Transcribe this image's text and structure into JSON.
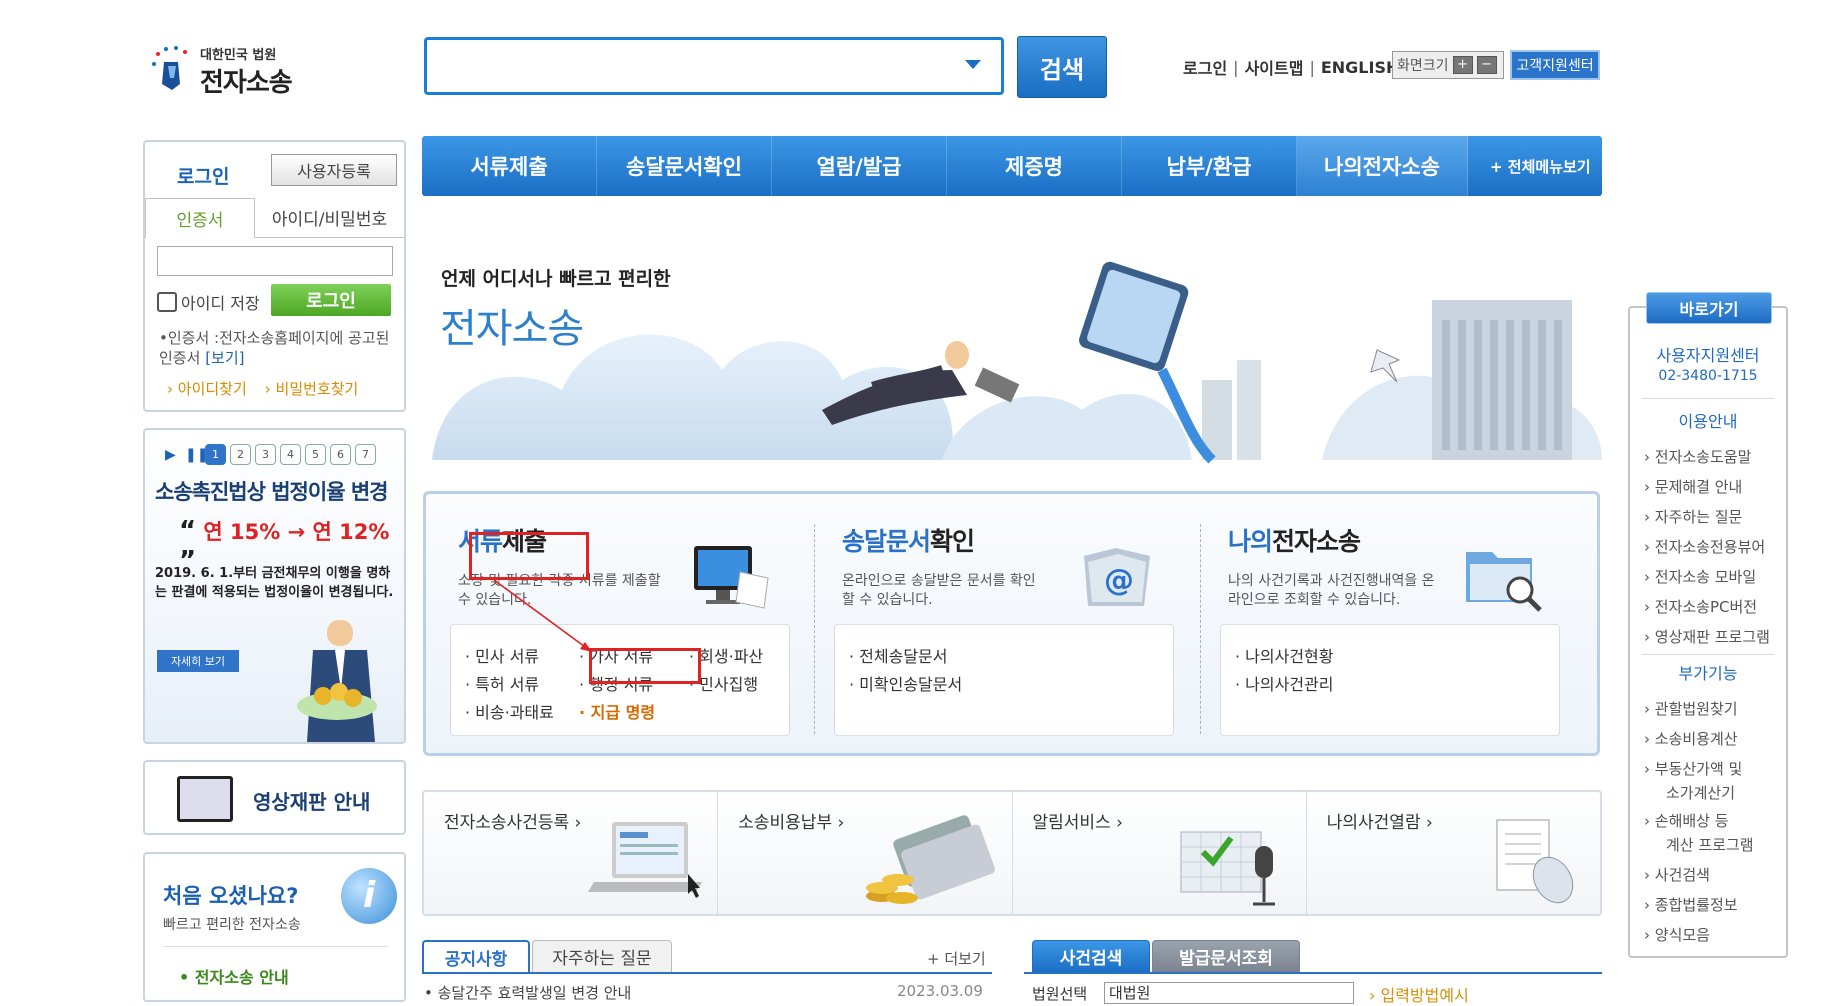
{
  "logo": {
    "small": "대한민국 법원",
    "big": "전자소송"
  },
  "search": {
    "placeholder": "",
    "button": "검색"
  },
  "util": {
    "login": "로그인",
    "sitemap": "사이트맵",
    "english": "ENGLISH",
    "font_size": "화면크기",
    "plus": "+",
    "minus": "−",
    "customer_center": "고객지원센터"
  },
  "nav": {
    "items": [
      "서류제출",
      "송달문서확인",
      "열람/발급",
      "제증명",
      "납부/환급",
      "나의전자소송"
    ],
    "all_menu": "+ 전체메뉴보기"
  },
  "login": {
    "title": "로그인",
    "register": "사용자등록",
    "tab_cert": "인증서",
    "tab_id": "아이디/비밀번호",
    "save_id": "아이디 저장",
    "login_button": "로그인",
    "note": "•인증서 :전자소송홈페이지에 공고된인증서",
    "note_link": "[보기]",
    "find_id": "› 아이디찾기",
    "find_pw": "› 비밀번호찾기"
  },
  "notice": {
    "pages": [
      "1",
      "2",
      "3",
      "4",
      "5",
      "6",
      "7"
    ],
    "title": "소송촉진법상 법정이율 변경",
    "rate": "연 15% → 연 12%",
    "body": "2019. 6. 1.부터 금전채무의 이행을 명하는 판결에 적용되는 법정이율이 변경됩니다.",
    "detail": "자세히 보기"
  },
  "video": {
    "label": "영상재판 안내"
  },
  "first_visit": {
    "title": "처음 오셨나요?",
    "subtitle": "빠르고 편리한 전자소송",
    "link": "• 전자소송 안내"
  },
  "banner": {
    "sub": "언제 어디서나 빠르고 편리한",
    "title": "전자소송"
  },
  "services": [
    {
      "title_hl": "서류",
      "title_rest": "제출",
      "desc": "소장 및 필요한 각종 서류를 제출할 수 있습니다.",
      "links": [
        "· 민사 서류",
        "· 가사 서류",
        "· 회생·파산",
        "· 특허 서류",
        "· 행정 서류",
        "· 민사집행",
        "· 비송·과태료",
        "· 지급 명령"
      ]
    },
    {
      "title_hl": "송달문서",
      "title_rest": "확인",
      "desc": "온라인으로 송달받은 문서를 확인 할 수 있습니다.",
      "links": [
        "· 전체송달문서",
        "· 미확인송달문서"
      ]
    },
    {
      "title_hl": "나의",
      "title_rest": "전자소송",
      "desc": "나의 사건기록과 사건진행내역을 온라인으로 조회할 수 있습니다.",
      "links": [
        "· 나의사건현황",
        "· 나의사건관리"
      ]
    }
  ],
  "tiles": [
    "전자소송사건등록 ›",
    "소송비용납부 ›",
    "알림서비스 ›",
    "나의사건열람 ›"
  ],
  "board": {
    "tab_notice": "공지사항",
    "tab_faq": "자주하는 질문",
    "more": "+ 더보기",
    "first_item": "• 송달간주 효력발생일 변경 안내",
    "first_date": "2023.03.09"
  },
  "case": {
    "tab_search": "사건검색",
    "tab_issue": "발급문서조회",
    "court_label": "법원선택",
    "court_value": "대법원",
    "input_example": "› 입력방법예시"
  },
  "quick": {
    "head": "바로가기",
    "center": "사용자지원센터",
    "phone": "02-3480-1715",
    "usage": "이용안내",
    "usage_links": [
      "› 전자소송도움말",
      "› 문제해결 안내",
      "› 자주하는 질문",
      "› 전자소송전용뷰어",
      "› 전자소송 모바일",
      "› 전자소송PC버전",
      "› 영상재판 프로그램"
    ],
    "extra": "부가기능",
    "extra_links": [
      "› 관할법원찾기",
      "› 소송비용계산",
      "› 부동산가액 및",
      "소가계산기",
      "› 손해배상 등",
      "계산 프로그램",
      "› 사건검색",
      "› 종합법률정보",
      "› 양식모음"
    ]
  },
  "colors": {
    "brand_blue": "#1a6ec3",
    "accent_green": "#4da624",
    "highlight_red": "#e02222"
  }
}
